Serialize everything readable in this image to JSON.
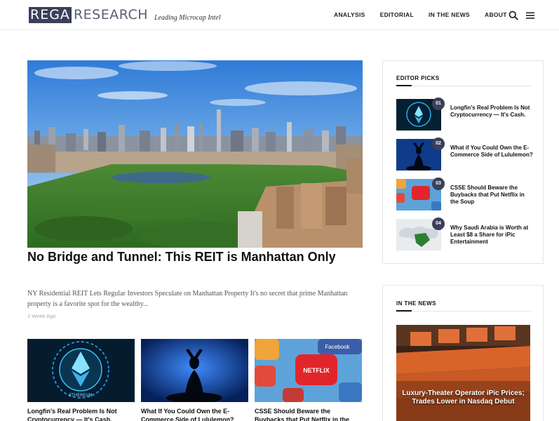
{
  "logo": {
    "rega": "REGA",
    "research": "RESEARCH",
    "tagline": "Leading Microcap Intel"
  },
  "nav": {
    "items": [
      "ANALYSIS",
      "EDITORIAL",
      "IN THE NEWS",
      "ABOUT"
    ]
  },
  "icons": {
    "search": "search-icon",
    "menu": "hamburger-menu-icon"
  },
  "colors": {
    "brand": "#3b3f58",
    "text": "#222222",
    "muted": "#aaaaaa"
  },
  "hero": {
    "title": "No Bridge and Tunnel: This REIT is Manhattan Only",
    "excerpt": "NY Residential REIT Lets Regular Investors Speculate on Manhattan Property   It's no secret that prime Manhattan property is a favorite spot for the wealthy...",
    "date": "1 Week Ago"
  },
  "cards": [
    {
      "title": "Longfin's Real Problem Is Not Cryptocurrency — It's Cash.",
      "image_text": "ETHEREUM"
    },
    {
      "title": "What If You Could Own the E-Commerce Side of Lululemon?"
    },
    {
      "title": "CSSE Should Beware the Buybacks that Put Netflix in the Soup",
      "image_text": "NETFLIX",
      "image_subtext": "Facebook"
    }
  ],
  "editor_picks": {
    "heading": "EDITOR PICKS",
    "items": [
      {
        "num": "01",
        "title": "Longfin's Real Problem Is Not Cryptocurrency — It's Cash."
      },
      {
        "num": "02",
        "title": "What if You Could Own the E-Commerce Side of Lululemon?"
      },
      {
        "num": "03",
        "title": "CSSE Should Beware the Buybacks that Put Netflix in the Soup"
      },
      {
        "num": "04",
        "title": "Why Saudi Arabia is Worth at Least $8 a Share for iPic Entertainment"
      }
    ]
  },
  "in_the_news": {
    "heading": "IN THE NEWS",
    "caption": "Luxury-Theater Operator iPic Prices; Trades Lower in Nasdaq Debut"
  }
}
